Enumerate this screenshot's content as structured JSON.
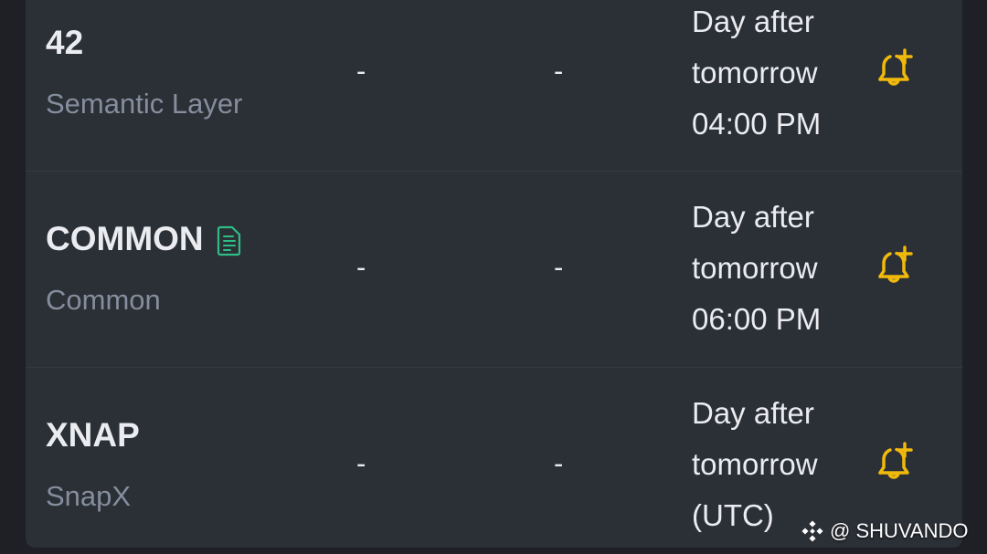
{
  "colors": {
    "background": "#1e2026",
    "panel": "#2b2f36",
    "primary_text": "#eaecef",
    "secondary_text": "#848e9c",
    "accent_bell": "#f0b90b",
    "doc_icon": "#2ebd85"
  },
  "rows": [
    {
      "symbol": "42",
      "name": "Semantic Layer",
      "col2": "-",
      "col3": "-",
      "time_line1": "Day after",
      "time_line2": "tomorrow",
      "time_line3": "04:00 PM",
      "icon": "bell-plus-icon"
    },
    {
      "symbol": "COMMON",
      "name": "Common",
      "col2": "-",
      "col3": "-",
      "time_line1": "Day after",
      "time_line2": "tomorrow",
      "time_line3": "06:00 PM",
      "icon": "bell-plus-icon",
      "badge_icon": "document-icon"
    },
    {
      "symbol": "XNAP",
      "name": "SnapX",
      "col2": "-",
      "col3": "-",
      "time_line1": "Day after",
      "time_line2": "tomorrow",
      "time_line3": "(UTC)",
      "icon": "bell-plus-icon"
    }
  ],
  "watermark": {
    "icon": "binance-logo-icon",
    "handle": "@ SHUVANDO"
  }
}
